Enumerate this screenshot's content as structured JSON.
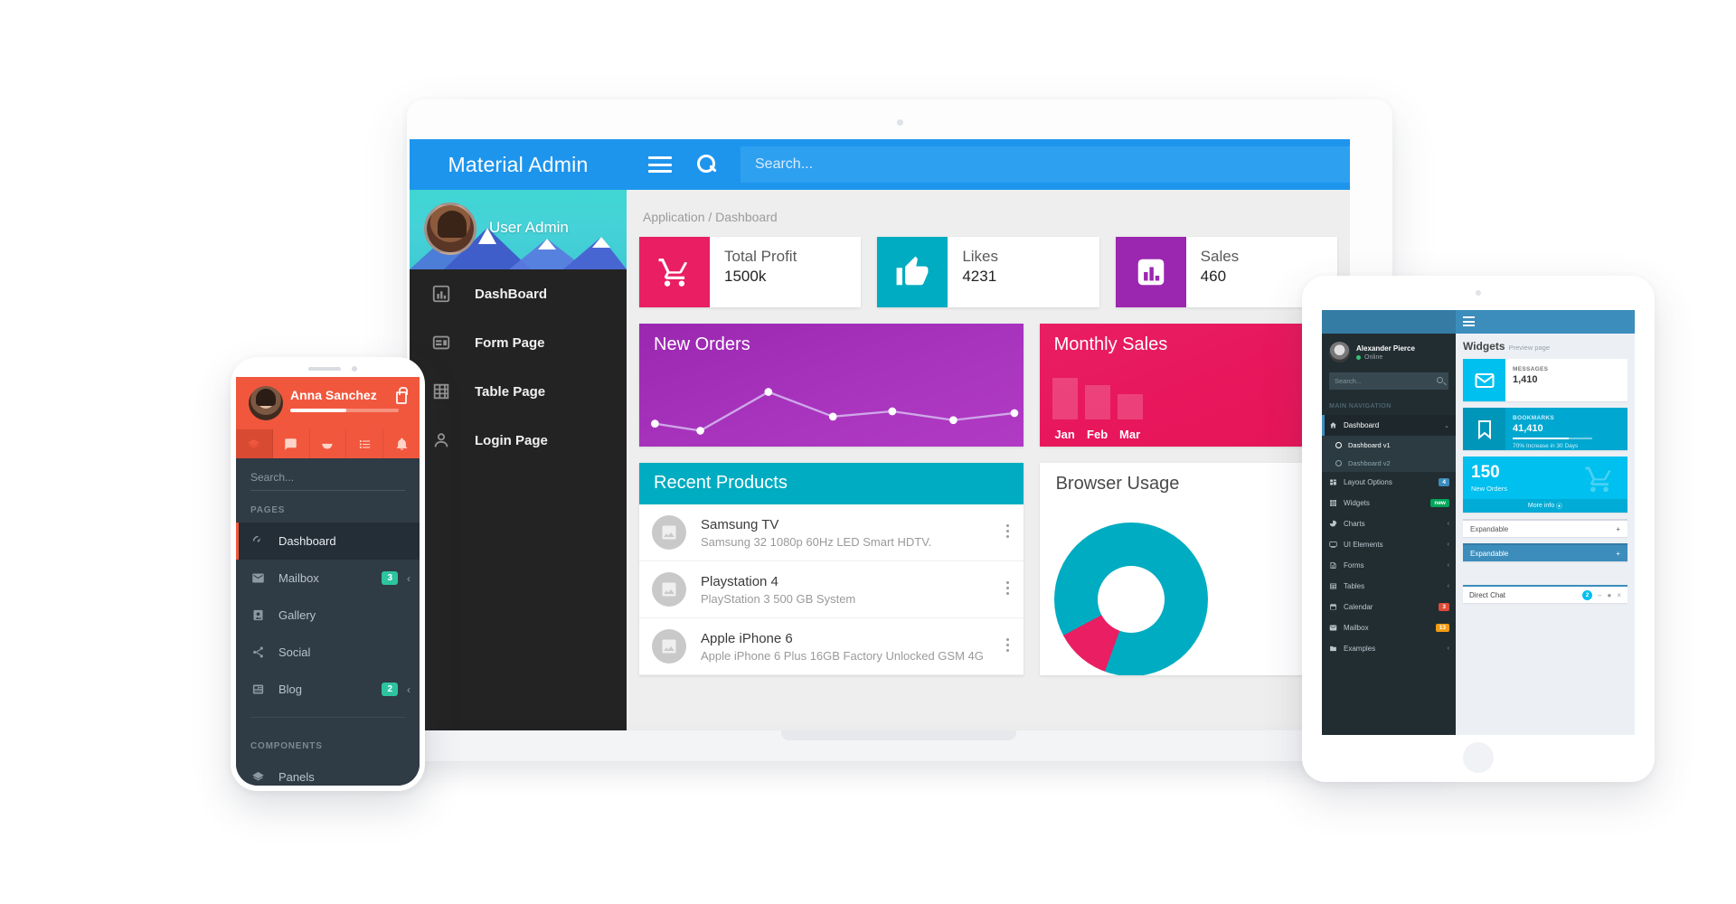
{
  "laptop": {
    "brand": "Material Admin",
    "search_placeholder": "Search...",
    "user_name": "User Admin",
    "nav": [
      {
        "label": "DashBoard",
        "icon": "chart-bar-icon"
      },
      {
        "label": "Form Page",
        "icon": "form-icon"
      },
      {
        "label": "Table Page",
        "icon": "table-grid-icon"
      },
      {
        "label": "Login Page",
        "icon": "person-icon"
      }
    ],
    "breadcrumb": "Application / Dashboard",
    "stats": [
      {
        "label": "Total Profit",
        "value": "1500k",
        "color": "#e91e63",
        "icon": "shopping-cart-icon"
      },
      {
        "label": "Likes",
        "value": "4231",
        "color": "#00acc1",
        "icon": "thumbs-up-icon"
      },
      {
        "label": "Sales",
        "value": "460",
        "color": "#9b27b0",
        "icon": "chart-bar-icon"
      }
    ],
    "orders_card": {
      "title": "New Orders",
      "color": "#9b27b0"
    },
    "monthly_card": {
      "title": "Monthly Sales",
      "color": "#e91e63",
      "months": [
        "Jan",
        "Feb",
        "Mar"
      ]
    },
    "products_card": {
      "title": "Recent Products",
      "color": "#00acc1",
      "items": [
        {
          "name": "Samsung TV",
          "desc": "Samsung 32 1080p 60Hz LED Smart HDTV."
        },
        {
          "name": "Playstation 4",
          "desc": "PlayStation 3 500 GB System"
        },
        {
          "name": "Apple iPhone 6",
          "desc": "Apple iPhone 6 Plus 16GB Factory Unlocked GSM 4G"
        }
      ]
    },
    "browser_card": {
      "title": "Browser Usage"
    }
  },
  "phone": {
    "user_name": "Anna Sanchez",
    "search_placeholder": "Search...",
    "section_pages": "PAGES",
    "section_components": "COMPONENTS",
    "tabs": [
      "layers-icon",
      "chat-icon",
      "pie-icon",
      "list-icon",
      "bell-icon"
    ],
    "items": [
      {
        "label": "Dashboard",
        "icon": "speedometer-icon",
        "badge": "",
        "chevron": false,
        "active": true
      },
      {
        "label": "Mailbox",
        "icon": "envelope-icon",
        "badge": "3",
        "chevron": true,
        "active": false
      },
      {
        "label": "Gallery",
        "icon": "gallery-icon",
        "badge": "",
        "chevron": false,
        "active": false
      },
      {
        "label": "Social",
        "icon": "share-icon",
        "badge": "",
        "chevron": false,
        "active": false
      },
      {
        "label": "Blog",
        "icon": "blog-icon",
        "badge": "2",
        "chevron": true,
        "active": false
      }
    ],
    "components": [
      {
        "label": "Panels",
        "icon": "layers-icon"
      }
    ],
    "badge_color": "#2cc5a0",
    "header_color": "#f1573d"
  },
  "tablet": {
    "user_name": "Alexander Pierce",
    "user_status": "Online",
    "search_placeholder": "Search...",
    "nav_header": "MAIN NAVIGATION",
    "nav": [
      {
        "label": "Dashboard",
        "icon": "dashboard-icon",
        "chevron": "⌄",
        "badge": "",
        "badge_color": "",
        "active": true
      },
      {
        "label": "Layout Options",
        "icon": "layout-icon",
        "chevron": "",
        "badge": "4",
        "badge_color": "#3c8dbc",
        "active": false
      },
      {
        "label": "Widgets",
        "icon": "widgets-icon",
        "chevron": "",
        "badge": "new",
        "badge_color": "#00a65a",
        "active": false
      },
      {
        "label": "Charts",
        "icon": "pie-icon",
        "chevron": "‹",
        "badge": "",
        "badge_color": "",
        "active": false
      },
      {
        "label": "UI Elements",
        "icon": "ui-icon",
        "chevron": "‹",
        "badge": "",
        "badge_color": "",
        "active": false
      },
      {
        "label": "Forms",
        "icon": "form-icon",
        "chevron": "‹",
        "badge": "",
        "badge_color": "",
        "active": false
      },
      {
        "label": "Tables",
        "icon": "table-icon",
        "chevron": "‹",
        "badge": "",
        "badge_color": "",
        "active": false
      },
      {
        "label": "Calendar",
        "icon": "calendar-icon",
        "chevron": "",
        "badge": "3",
        "badge_color": "#dd4b39",
        "active": false
      },
      {
        "label": "Mailbox",
        "icon": "envelope-icon",
        "chevron": "",
        "badge": "13",
        "badge_color": "#f39c12",
        "active": false
      },
      {
        "label": "Examples",
        "icon": "folder-icon",
        "chevron": "‹",
        "badge": "",
        "badge_color": "",
        "active": false
      }
    ],
    "sub_items": [
      {
        "label": "Dashboard v1",
        "on": true
      },
      {
        "label": "Dashboard v2",
        "on": false
      }
    ],
    "page_title": "Widgets",
    "page_subtitle": "Preview page",
    "widgets": [
      {
        "label": "MESSAGES",
        "value": "1,410",
        "icon": "envelope-icon",
        "style": "white"
      },
      {
        "label": "BOOKMARKS",
        "value": "41,410",
        "icon": "bookmark-icon",
        "style": "filled",
        "note": "70% Increase in 30 Days",
        "progress": "70%"
      }
    ],
    "orders_widget": {
      "number": "150",
      "label": "New Orders",
      "more": "More info",
      "icon": "shopping-cart-icon"
    },
    "expandables": [
      {
        "label": "Expandable",
        "plus": "+",
        "style": "white"
      },
      {
        "label": "Expandable",
        "plus": "+",
        "style": "blue"
      }
    ],
    "direct_chat": {
      "label": "Direct Chat",
      "badge": "2"
    }
  }
}
